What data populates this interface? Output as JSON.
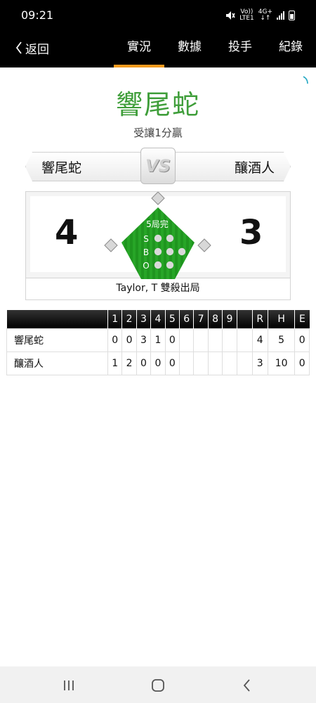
{
  "status": {
    "time": "09:21",
    "net_top": "Vo))",
    "net_bottom": "LTE1",
    "gen_top": "4G+",
    "gen_bottom": "↓↑"
  },
  "nav": {
    "back_label": "返回",
    "tabs": [
      {
        "label": "實況",
        "active": true
      },
      {
        "label": "數據"
      },
      {
        "label": "投手"
      },
      {
        "label": "紀錄"
      }
    ]
  },
  "game": {
    "title": "響尾蛇",
    "handicap": "受讓1分贏",
    "away_team": "響尾蛇",
    "home_team": "釀酒人",
    "vs_label": "VS",
    "away_score": "4",
    "home_score": "3",
    "inning_status": "5局完",
    "count_labels": {
      "s": "S",
      "b": "B",
      "o": "O"
    },
    "last_play": "Taylor, T 雙殺出局"
  },
  "linescore": {
    "headers": [
      "1",
      "2",
      "3",
      "4",
      "5",
      "6",
      "7",
      "8",
      "9",
      "",
      "R",
      "H",
      "E"
    ],
    "rows": [
      {
        "team": "響尾蛇",
        "cells": [
          "0",
          "0",
          "3",
          "1",
          "0",
          "",
          "",
          "",
          "",
          "",
          "4",
          "5",
          "0"
        ]
      },
      {
        "team": "釀酒人",
        "cells": [
          "1",
          "2",
          "0",
          "0",
          "0",
          "",
          "",
          "",
          "",
          "",
          "3",
          "10",
          "0"
        ]
      }
    ]
  },
  "colors": {
    "accent": "#f39a1e",
    "team_green": "#3f9e3a",
    "field_green": "#27a527"
  }
}
